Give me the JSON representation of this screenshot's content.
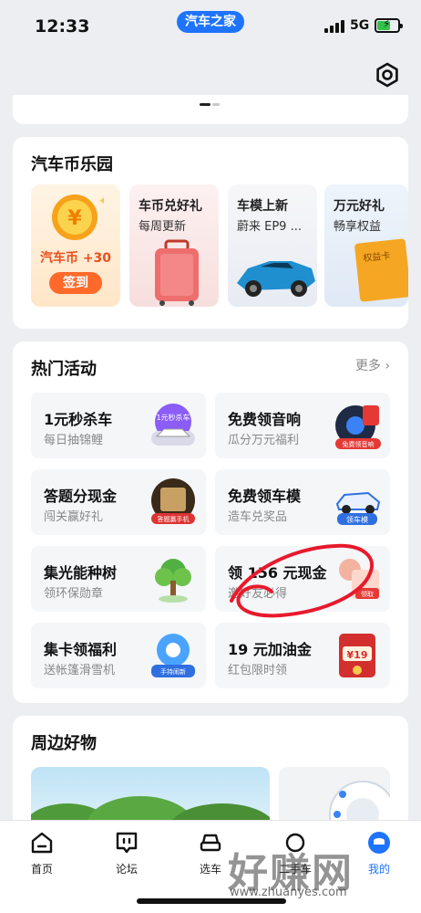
{
  "status": {
    "time": "12:33",
    "app_pill": "汽车之家",
    "network": "5G"
  },
  "coin_park": {
    "title": "汽车币乐园",
    "items": [
      {
        "line1": "汽车币 +30",
        "line2": "签到"
      },
      {
        "line1": "车币兑好礼",
        "line2": "每周更新"
      },
      {
        "line1": "车模上新",
        "line2": "蔚来 EP9 ..."
      },
      {
        "line1": "万元好礼",
        "line2": "畅享权益",
        "badge": "权益卡"
      }
    ]
  },
  "hot": {
    "title": "热门活动",
    "more": "更多",
    "items": [
      {
        "title": "1元秒杀车",
        "sub": "每日抽锦鲤",
        "badge": "1元秒杀车"
      },
      {
        "title": "免费领音响",
        "sub": "瓜分万元福利",
        "badge": "免费领音响"
      },
      {
        "title": "答题分现金",
        "sub": "闯关赢好礼",
        "badge": "答题赢手机"
      },
      {
        "title": "免费领车模",
        "sub": "造车兑奖品",
        "badge": "领车模"
      },
      {
        "title": "集光能种树",
        "sub": "领环保勋章"
      },
      {
        "title": "领 156 元现金",
        "sub": "邀好友必得",
        "badge": "领取"
      },
      {
        "title": "集卡领福利",
        "sub": "送帐篷滑雪机",
        "badge": "手持闹新"
      },
      {
        "title": "19 元加油金",
        "sub": "红包限时领",
        "badge": "¥19"
      }
    ]
  },
  "nearby": {
    "title": "周边好物"
  },
  "tabs": [
    {
      "label": "首页"
    },
    {
      "label": "论坛"
    },
    {
      "label": "选车"
    },
    {
      "label": "二手车"
    },
    {
      "label": "我的"
    }
  ],
  "watermark": {
    "big": "好赚网",
    "small": "www.zhuanyes.com"
  },
  "colors": {
    "brand": "#1e73ff",
    "coin": "#f7a21b",
    "red": "#e53935",
    "scribble": "#e8192c"
  }
}
